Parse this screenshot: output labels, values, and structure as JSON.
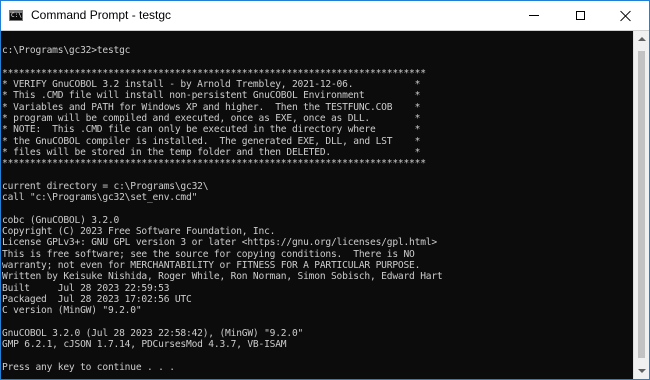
{
  "window": {
    "title": "Command Prompt - testgc",
    "app_icon_glyph": "C:\\"
  },
  "console": {
    "lines": [
      "",
      "c:\\Programs\\gc32>testgc",
      "",
      "****************************************************************************",
      "* VERIFY GnuCOBOL 3.2 install - by Arnold Trembley, 2021-12-06.           *",
      "* This .CMD file will install non-persistent GnuCOBOL Environment         *",
      "* Variables and PATH for Windows XP and higher.  Then the TESTFUNC.COB    *",
      "* program will be compiled and executed, once as EXE, once as DLL.        *",
      "* NOTE:  This .CMD file can only be executed in the directory where       *",
      "* the GnuCOBOL compiler is installed.  The generated EXE, DLL, and LST    *",
      "* files will be stored in the temp folder and then DELETED.               *",
      "****************************************************************************",
      "",
      "current directory = c:\\Programs\\gc32\\",
      "call \"c:\\Programs\\gc32\\set_env.cmd\"",
      "",
      "cobc (GnuCOBOL) 3.2.0",
      "Copyright (C) 2023 Free Software Foundation, Inc.",
      "License GPLv3+: GNU GPL version 3 or later <https://gnu.org/licenses/gpl.html>",
      "This is free software; see the source for copying conditions.  There is NO",
      "warranty; not even for MERCHANTABILITY or FITNESS FOR A PARTICULAR PURPOSE.",
      "Written by Keisuke Nishida, Roger While, Ron Norman, Simon Sobisch, Edward Hart",
      "Built     Jul 28 2023 22:59:53",
      "Packaged  Jul 28 2023 17:02:56 UTC",
      "C version (MinGW) \"9.2.0\"",
      "",
      "GnuCOBOL 3.2.0 (Jul 28 2023 22:58:42), (MinGW) \"9.2.0\"",
      "GMP 6.2.1, cJSON 1.7.14, PDCursesMod 4.3.7, VB-ISAM",
      "",
      "Press any key to continue . . ."
    ]
  },
  "icons": {
    "minimize": "minimize-icon",
    "maximize": "maximize-icon",
    "close": "close-icon",
    "scroll_up": "chevron-up-icon",
    "scroll_down": "chevron-down-icon"
  },
  "colors": {
    "console_bg": "#0c0c0c",
    "console_fg": "#cccccc",
    "titlebar_bg": "#ffffff",
    "window_border": "#1f80d6"
  }
}
